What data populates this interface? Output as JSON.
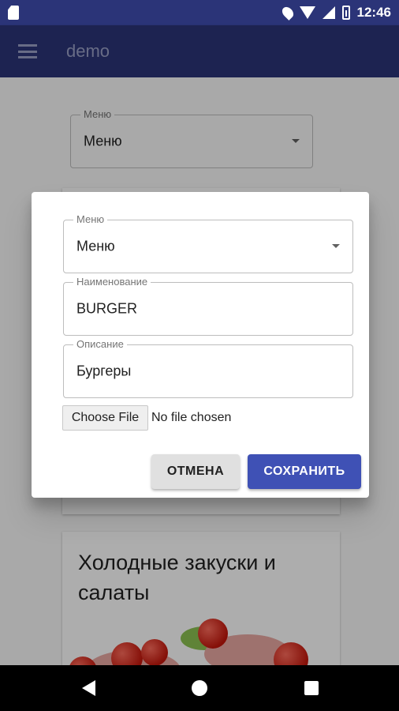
{
  "status_bar": {
    "time": "12:46"
  },
  "app_bar": {
    "title": "demo"
  },
  "background": {
    "menu_field": {
      "legend": "Меню",
      "value": "Меню"
    },
    "card": {
      "title": "Холодные закуски и салаты"
    }
  },
  "dialog": {
    "menu_field": {
      "legend": "Меню",
      "value": "Меню"
    },
    "name_field": {
      "legend": "Наименование",
      "value": "BURGER"
    },
    "description_field": {
      "legend": "Описание",
      "value": "Бургеры"
    },
    "file": {
      "button_label": "Choose File",
      "status": "No file chosen"
    },
    "cancel_label": "ОТМЕНА",
    "save_label": "СОХРАНИТЬ"
  },
  "colors": {
    "primary": "#3f51b5",
    "app_bar": "#2b3478"
  },
  "icons": [
    "sd-card-icon",
    "location-icon",
    "wifi-icon",
    "cell-signal-icon",
    "battery-icon",
    "menu-icon",
    "dropdown-caret-icon",
    "back-icon",
    "home-icon",
    "recents-icon"
  ]
}
